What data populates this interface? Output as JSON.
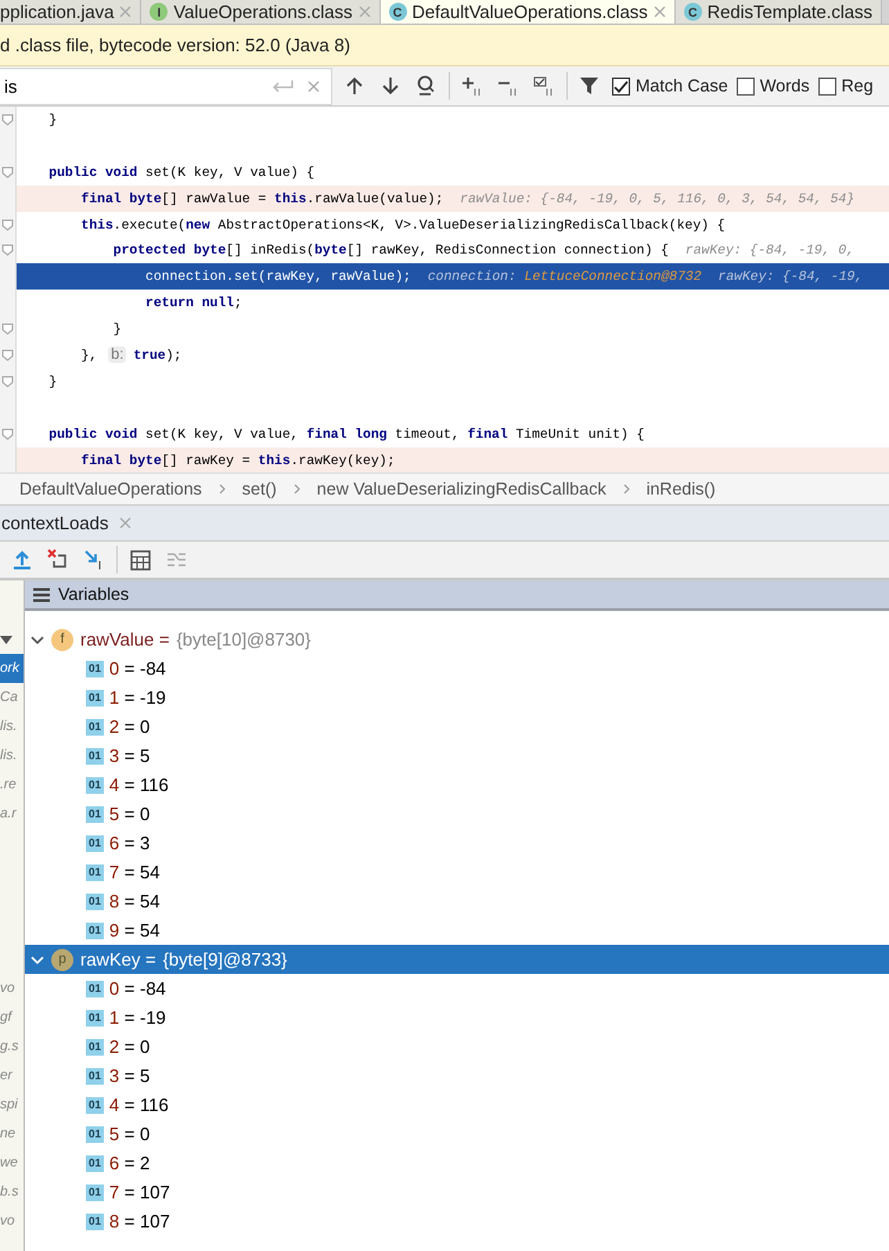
{
  "tabs": [
    {
      "label": "pplication.java",
      "selected": false,
      "closable": true
    },
    {
      "badge": "I",
      "label": "ValueOperations.class",
      "selected": false,
      "closable": true
    },
    {
      "badge": "C",
      "label": "DefaultValueOperations.class",
      "selected": true,
      "closable": true
    },
    {
      "badge": "C",
      "label": "RedisTemplate.class",
      "selected": false,
      "closable": false
    }
  ],
  "banner": "d .class file, bytecode version: 52.0 (Java 8)",
  "search": {
    "value": "is",
    "options": [
      {
        "label": "Match Case",
        "checked": true
      },
      {
        "label": "Words",
        "checked": false
      },
      {
        "label": "Reg",
        "checked": false
      }
    ]
  },
  "code_lines": [
    {
      "fold": true,
      "breakpoint": false,
      "current": false,
      "text": "    }"
    },
    {
      "fold": false,
      "breakpoint": false,
      "current": false
    },
    {
      "fold": true,
      "breakpoint": false,
      "current": false,
      "text": "    **public void** set(K key, V value) {"
    },
    {
      "fold": false,
      "breakpoint": true,
      "current": false,
      "text": "        **final byte**[] rawValue = **this**.rawValue(value);",
      "hint": "rawValue: {-84, -19, 0, 5, 116, 0, 3, 54, 54, 54}"
    },
    {
      "fold": true,
      "breakpoint": false,
      "current": false,
      "text": "        **this**.execute(**new** AbstractOperations<K, V>.ValueDeserializingRedisCallback(key) {"
    },
    {
      "fold": true,
      "breakpoint": false,
      "current": false,
      "text": "            **protected byte**[] inRedis(**byte**[] rawKey, RedisConnection connection) {",
      "hint": "rawKey: {-84, -19, 0,"
    },
    {
      "fold": false,
      "breakpoint": false,
      "current": true,
      "text": "                connection.set(rawKey, rawValue);",
      "hint": "connection:",
      "hint_object": "LettuceConnection@8732",
      "hint_2": "rawKey: {-84, -19,"
    },
    {
      "fold": false,
      "breakpoint": false,
      "current": false,
      "text": "                **return null**;"
    },
    {
      "fold": true,
      "breakpoint": false,
      "current": false,
      "text": "            }"
    },
    {
      "fold": true,
      "breakpoint": false,
      "current": false,
      "text": "        },",
      "param_hint": "b:",
      "text_after": "**true**);"
    },
    {
      "fold": true,
      "breakpoint": false,
      "current": false,
      "text": "    }"
    },
    {
      "fold": false,
      "breakpoint": false,
      "current": false
    },
    {
      "fold": true,
      "breakpoint": false,
      "current": false,
      "text": "    **public void** set(K key, V value, **final long** timeout, **final** TimeUnit unit) {"
    },
    {
      "fold": false,
      "breakpoint": true,
      "current": false,
      "text": "        **final byte**[] rawKey = **this**.rawKey(key);"
    }
  ],
  "breadcrumbs": [
    "DefaultValueOperations",
    "set()",
    "new ValueDeserializingRedisCallback",
    "inRedis()"
  ],
  "debug_tab": {
    "label": "contextLoads"
  },
  "variables": {
    "title": "Variables",
    "frames": [
      {
        "label": "ork",
        "selected": true
      },
      {
        "label": "Ca",
        "selected": false
      },
      {
        "label": "lis.",
        "selected": false
      },
      {
        "label": "lis.",
        "selected": false
      },
      {
        "label": ".re",
        "selected": false
      },
      {
        "label": "a.r",
        "selected": false
      }
    ],
    "lower_frames": [
      "vo",
      "gf",
      "g.s",
      "er",
      "spi",
      "ne",
      "we",
      "b.s",
      "vo"
    ],
    "items": [
      {
        "kind": "field",
        "badge": "f",
        "name": "rawValue",
        "eq": "=",
        "value": "{byte[10]@8730}",
        "expanded": true,
        "selected": false,
        "children": [
          {
            "icon": "01",
            "index": "0",
            "eq": "=",
            "value": "-84"
          },
          {
            "icon": "01",
            "index": "1",
            "eq": "=",
            "value": "-19"
          },
          {
            "icon": "01",
            "index": "2",
            "eq": "=",
            "value": "0"
          },
          {
            "icon": "01",
            "index": "3",
            "eq": "=",
            "value": "5"
          },
          {
            "icon": "01",
            "index": "4",
            "eq": "=",
            "value": "116"
          },
          {
            "icon": "01",
            "index": "5",
            "eq": "=",
            "value": "0"
          },
          {
            "icon": "01",
            "index": "6",
            "eq": "=",
            "value": "3"
          },
          {
            "icon": "01",
            "index": "7",
            "eq": "=",
            "value": "54"
          },
          {
            "icon": "01",
            "index": "8",
            "eq": "=",
            "value": "54"
          },
          {
            "icon": "01",
            "index": "9",
            "eq": "=",
            "value": "54"
          }
        ]
      },
      {
        "kind": "param",
        "badge": "p",
        "name": "rawKey",
        "eq": "=",
        "value": "{byte[9]@8733}",
        "expanded": true,
        "selected": true,
        "children": [
          {
            "icon": "01",
            "index": "0",
            "eq": "=",
            "value": "-84"
          },
          {
            "icon": "01",
            "index": "1",
            "eq": "=",
            "value": "-19"
          },
          {
            "icon": "01",
            "index": "2",
            "eq": "=",
            "value": "0"
          },
          {
            "icon": "01",
            "index": "3",
            "eq": "=",
            "value": "5"
          },
          {
            "icon": "01",
            "index": "4",
            "eq": "=",
            "value": "116"
          },
          {
            "icon": "01",
            "index": "5",
            "eq": "=",
            "value": "0"
          },
          {
            "icon": "01",
            "index": "6",
            "eq": "=",
            "value": "2"
          },
          {
            "icon": "01",
            "index": "7",
            "eq": "=",
            "value": "107"
          },
          {
            "icon": "01",
            "index": "8",
            "eq": "=",
            "value": "107"
          }
        ]
      }
    ]
  }
}
